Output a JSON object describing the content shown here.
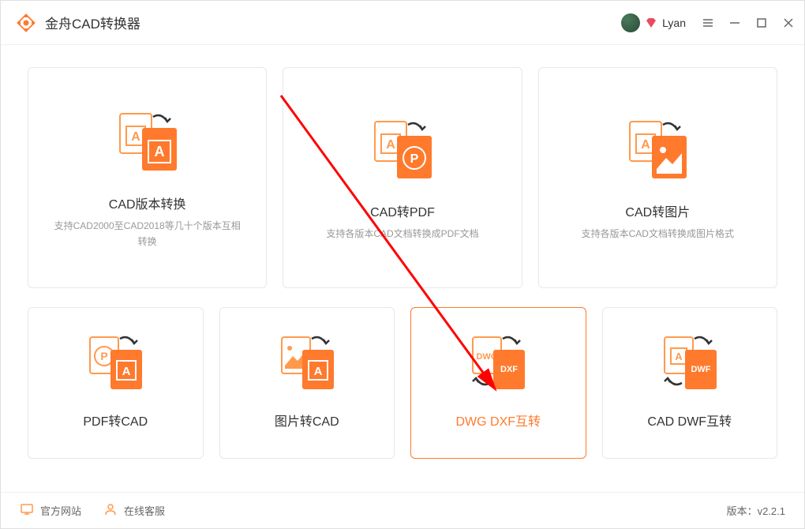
{
  "app": {
    "title": "金舟CAD转换器"
  },
  "user": {
    "name": "Lyan"
  },
  "cards": {
    "top": [
      {
        "title": "CAD版本转换",
        "desc": "支持CAD2000至CAD2018等几十个版本互相转换"
      },
      {
        "title": "CAD转PDF",
        "desc": "支持各版本CAD文档转换成PDF文档"
      },
      {
        "title": "CAD转图片",
        "desc": "支持各版本CAD文档转换成图片格式"
      }
    ],
    "bottom": [
      {
        "title": "PDF转CAD"
      },
      {
        "title": "图片转CAD"
      },
      {
        "title": "DWG DXF互转"
      },
      {
        "title": "CAD DWF互转"
      }
    ]
  },
  "footer": {
    "website": "官方网站",
    "support": "在线客服",
    "version_label": "版本：",
    "version": "v2.2.1"
  }
}
